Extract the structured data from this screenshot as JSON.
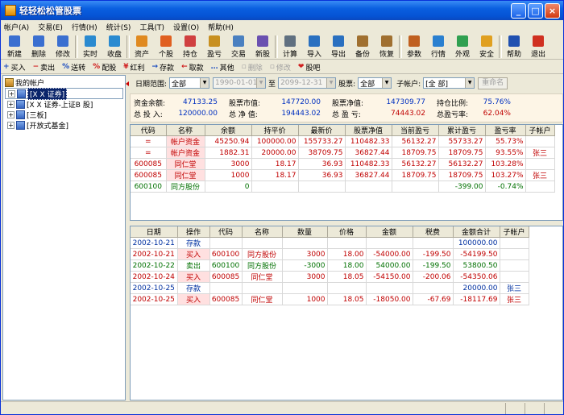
{
  "window": {
    "title": "轻轻松松管股票",
    "btn_min": "_",
    "btn_max": "□",
    "btn_close": "×"
  },
  "menu": [
    "帐户(A)",
    "交易(E)",
    "行情(H)",
    "统计(S)",
    "工具(T)",
    "设置(O)",
    "帮助(H)"
  ],
  "toolbar": [
    {
      "label": "新建",
      "icon": "new-icon",
      "color": "#3a6fd0"
    },
    {
      "label": "删除",
      "icon": "delete-icon",
      "color": "#3a6fd0"
    },
    {
      "label": "修改",
      "icon": "edit-icon",
      "color": "#3a6fd0"
    },
    {
      "label": "实时",
      "icon": "clock-icon",
      "color": "#2a8ad0"
    },
    {
      "label": "收盘",
      "icon": "clock-icon",
      "color": "#2a8ad0"
    },
    {
      "label": "资产",
      "icon": "bar-chart-icon",
      "color": "#e08a20"
    },
    {
      "label": "个股",
      "icon": "bar-chart-icon",
      "color": "#e06020"
    },
    {
      "label": "持仓",
      "icon": "pie-chart-icon",
      "color": "#d04040"
    },
    {
      "label": "盈亏",
      "icon": "bar-chart-icon",
      "color": "#c89020"
    },
    {
      "label": "交易",
      "icon": "bar-chart-icon",
      "color": "#4a80c0"
    },
    {
      "label": "新股",
      "icon": "bar-chart-icon",
      "color": "#6a50b0"
    },
    {
      "label": "计算",
      "icon": "calculator-icon",
      "color": "#607080"
    },
    {
      "label": "导入",
      "icon": "import-icon",
      "color": "#2a70c0"
    },
    {
      "label": "导出",
      "icon": "export-icon",
      "color": "#2a70c0"
    },
    {
      "label": "备份",
      "icon": "backup-icon",
      "color": "#a07030"
    },
    {
      "label": "恢复",
      "icon": "restore-icon",
      "color": "#a07030"
    },
    {
      "label": "参数",
      "icon": "params-icon",
      "color": "#c06020"
    },
    {
      "label": "行情",
      "icon": "quote-icon",
      "color": "#2a80d0"
    },
    {
      "label": "外观",
      "icon": "appearance-icon",
      "color": "#30a050"
    },
    {
      "label": "安全",
      "icon": "security-icon",
      "color": "#e0a020"
    },
    {
      "label": "帮助",
      "icon": "help-icon",
      "color": "#2050b0"
    },
    {
      "label": "退出",
      "icon": "exit-icon",
      "color": "#d03020"
    }
  ],
  "toolbar2": [
    {
      "label": "买入",
      "glyph": "+",
      "color": "#2050c0",
      "enabled": true
    },
    {
      "label": "卖出",
      "glyph": "−",
      "color": "#d02020",
      "enabled": true
    },
    {
      "label": "送转",
      "glyph": "%",
      "color": "#2050c0",
      "enabled": true
    },
    {
      "label": "配股",
      "glyph": "%",
      "color": "#d02020",
      "enabled": true
    },
    {
      "label": "红利",
      "glyph": "¥",
      "color": "#d02020",
      "enabled": true
    },
    {
      "label": "存款",
      "glyph": "→",
      "color": "#2050c0",
      "enabled": true
    },
    {
      "label": "取款",
      "glyph": "←",
      "color": "#d02020",
      "enabled": true
    },
    {
      "label": "其他",
      "glyph": "…",
      "color": "#2050c0",
      "enabled": true
    },
    {
      "label": "删除",
      "glyph": "▫",
      "color": "#a0a0a0",
      "enabled": false
    },
    {
      "label": "修改",
      "glyph": "▫",
      "color": "#a0a0a0",
      "enabled": false
    },
    {
      "label": "股吧",
      "glyph": "❤",
      "color": "#d02020",
      "enabled": true
    }
  ],
  "tree": {
    "root": "我的帐户",
    "nodes": [
      {
        "label": "[X X 证券]",
        "selected": true
      },
      {
        "label": "[X X 证券-上证B 股]",
        "selected": false
      },
      {
        "label": "[三板]",
        "selected": false
      },
      {
        "label": "[开放式基金]",
        "selected": false
      }
    ]
  },
  "filter": {
    "date_range_label": "日期范围:",
    "date_range_value": "全部",
    "date_from": "1990-01-01",
    "to_label": "至",
    "date_to": "2099-12-31",
    "stock_label": "股票:",
    "stock_value": "全部",
    "subaccount_label": "子帐户:",
    "subaccount_value": "[全  部]",
    "rename_label": "重命名"
  },
  "summary": {
    "row1": [
      {
        "label": "资金余额:",
        "value": "47133.25"
      },
      {
        "label": "股票市值:",
        "value": "147720.00"
      },
      {
        "label": "股票净值:",
        "value": "147309.77"
      },
      {
        "label": "持仓比例:",
        "value": "75.76%"
      }
    ],
    "row2": [
      {
        "label": "总 投 入:",
        "value": "120000.00"
      },
      {
        "label": "总 净 值:",
        "value": "194443.02"
      },
      {
        "label": "总 盈 亏:",
        "value": "74443.02"
      },
      {
        "label": "总盈亏率:",
        "value": "62.04%"
      }
    ]
  },
  "holdings": {
    "columns": [
      "代码",
      "名称",
      "余额",
      "持平价",
      "最新价",
      "股票净值",
      "当前盈亏",
      "累计盈亏",
      "盈亏率",
      "子帐户"
    ],
    "rows": [
      {
        "style": "red",
        "cells": [
          "=",
          "帐户资金",
          "45250.94",
          "100000.00",
          "155733.27",
          "110482.33",
          "56132.27",
          "55733.27",
          "55.73%",
          ""
        ]
      },
      {
        "style": "red",
        "cells": [
          "=",
          "帐户资金",
          "1882.31",
          "20000.00",
          "38709.75",
          "36827.44",
          "18709.75",
          "18709.75",
          "93.55%",
          "张三"
        ]
      },
      {
        "style": "red",
        "cells": [
          "600085",
          "同仁堂",
          "3000",
          "18.17",
          "36.93",
          "110482.33",
          "56132.27",
          "56132.27",
          "103.28%",
          ""
        ]
      },
      {
        "style": "red",
        "cells": [
          "600085",
          "同仁堂",
          "1000",
          "18.17",
          "36.93",
          "36827.44",
          "18709.75",
          "18709.75",
          "103.27%",
          "张三"
        ]
      },
      {
        "style": "green",
        "cells": [
          "600100",
          "同方股份",
          "0",
          "",
          "",
          "",
          "",
          "-399.00",
          "-0.74%",
          ""
        ]
      }
    ]
  },
  "trades": {
    "columns": [
      "日期",
      "操作",
      "代码",
      "名称",
      "数量",
      "价格",
      "金额",
      "税费",
      "金额合计",
      "子帐户"
    ],
    "rows": [
      {
        "style": "blue",
        "cells": [
          "2002-10-21",
          "存款",
          "",
          "",
          "",
          "",
          "",
          "",
          "100000.00",
          ""
        ]
      },
      {
        "style": "red",
        "cells": [
          "2002-10-21",
          "买入",
          "600100",
          "同方股份",
          "3000",
          "18.00",
          "-54000.00",
          "-199.50",
          "-54199.50",
          ""
        ]
      },
      {
        "style": "green",
        "cells": [
          "2002-10-22",
          "卖出",
          "600100",
          "同方股份",
          "-3000",
          "18.00",
          "54000.00",
          "-199.50",
          "53800.50",
          ""
        ]
      },
      {
        "style": "red",
        "cells": [
          "2002-10-24",
          "买入",
          "600085",
          "同仁堂",
          "3000",
          "18.05",
          "-54150.00",
          "-200.06",
          "-54350.06",
          ""
        ]
      },
      {
        "style": "blue",
        "cells": [
          "2002-10-25",
          "存款",
          "",
          "",
          "",
          "",
          "",
          "",
          "20000.00",
          "张三"
        ]
      },
      {
        "style": "red",
        "cells": [
          "2002-10-25",
          "买入",
          "600085",
          "同仁堂",
          "1000",
          "18.05",
          "-18050.00",
          "-67.69",
          "-18117.69",
          "张三"
        ]
      }
    ]
  }
}
